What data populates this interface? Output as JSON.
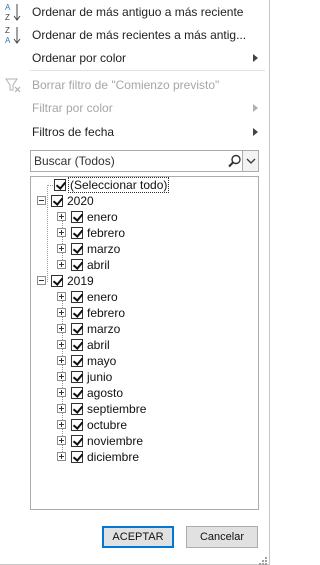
{
  "menu": {
    "sort_asc": "Ordenar de más antiguo a más reciente",
    "sort_desc": "Ordenar de más recientes a más antig...",
    "sort_color": "Ordenar por color",
    "clear_filter": "Borrar filtro de \"Comienzo previsto\"",
    "filter_color": "Filtrar por color",
    "date_filters": "Filtros de fecha"
  },
  "search": {
    "placeholder": "Buscar (Todos)"
  },
  "tree": {
    "select_all": "(Seleccionar todo)",
    "years": [
      {
        "label": "2020",
        "months": [
          "enero",
          "febrero",
          "marzo",
          "abril"
        ]
      },
      {
        "label": "2019",
        "months": [
          "enero",
          "febrero",
          "marzo",
          "abril",
          "mayo",
          "junio",
          "agosto",
          "septiembre",
          "octubre",
          "noviembre",
          "diciembre"
        ]
      }
    ]
  },
  "buttons": {
    "ok": "ACEPTAR",
    "cancel": "Cancelar"
  },
  "colors": {
    "accent": "#0078d7",
    "disabled": "#a6a6a6",
    "az_blue": "#2e75b6",
    "az_dark": "#444444"
  }
}
